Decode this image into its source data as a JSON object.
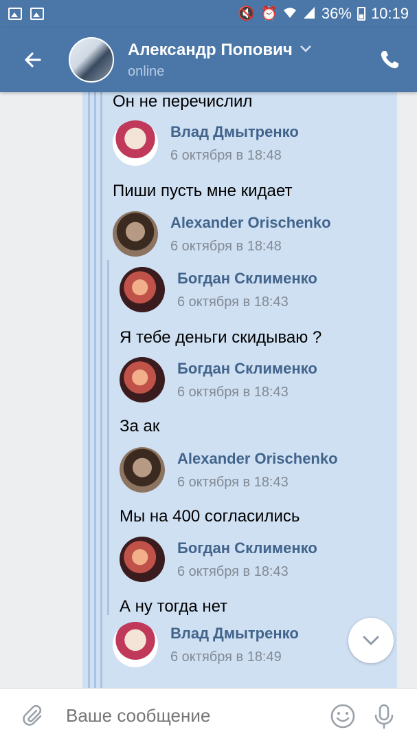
{
  "status_bar": {
    "battery": "36%",
    "time": "10:19"
  },
  "header": {
    "contact_name": "Александр Попович",
    "status": "online"
  },
  "messages": [
    {
      "text": "Он не перечислил"
    },
    {
      "quote_author": "Влад Дмытренко",
      "quote_time": "6 октября в 18:48",
      "text": "Пиши пусть мне кидает"
    },
    {
      "quote_author": "Alexander Orischenko",
      "quote_time": "6 октября в 18:48"
    },
    {
      "quote_author": "Богдан Склименко",
      "quote_time": "6 октября в 18:43",
      "text": "Я тебе деньги скидываю ?"
    },
    {
      "quote_author": "Богдан Склименко",
      "quote_time": "6 октября в 18:43",
      "text": "За ак"
    },
    {
      "quote_author": "Alexander Orischenko",
      "quote_time": "6 октября в 18:43",
      "text": "Мы на 400 согласились"
    },
    {
      "quote_author": "Богдан Склименко",
      "quote_time": "6 октября в 18:43",
      "text": "А ну тогда нет"
    },
    {
      "quote_author": "Влад Дмытренко",
      "quote_time": "6 октября в 18:49"
    }
  ],
  "composer": {
    "placeholder": "Ваше сообщение"
  },
  "colors": {
    "header": "#4a76a8",
    "bubble": "#cfe0f3",
    "author": "#42648b"
  },
  "icons": [
    "image-icon",
    "mute-icon",
    "alarm-icon",
    "wifi-icon",
    "signal-icon",
    "battery-icon",
    "back-arrow-icon",
    "chevron-down-icon",
    "phone-icon",
    "attach-icon",
    "emoji-icon",
    "mic-icon"
  ]
}
